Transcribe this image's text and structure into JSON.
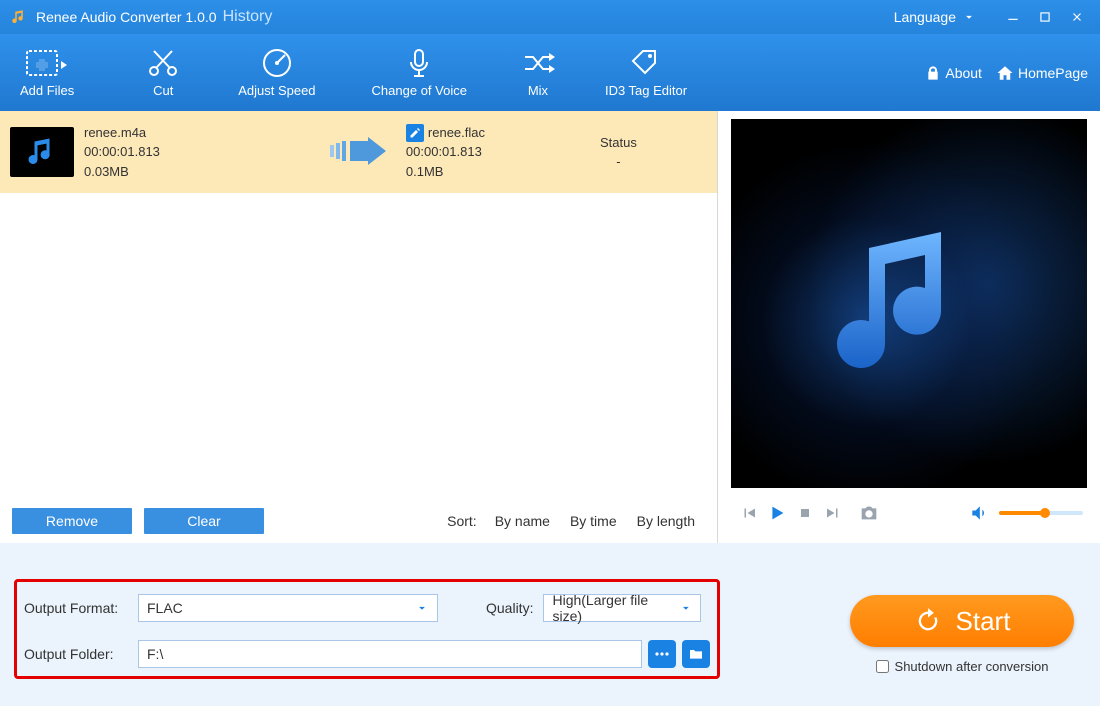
{
  "title": {
    "app": "Renee Audio Converter 1.0.0",
    "history": "History"
  },
  "window": {
    "language": "Language"
  },
  "toolbar": {
    "addfiles": "Add Files",
    "cut": "Cut",
    "adjust": "Adjust Speed",
    "voice": "Change of Voice",
    "mix": "Mix",
    "id3": "ID3 Tag Editor",
    "about": "About",
    "homepage": "HomePage"
  },
  "file": {
    "src": {
      "name": "renee.m4a",
      "duration": "00:00:01.813",
      "size": "0.03MB"
    },
    "dst": {
      "name": "renee.flac",
      "duration": "00:00:01.813",
      "size": "0.1MB"
    },
    "status_label": "Status",
    "status_value": "-"
  },
  "listfooter": {
    "remove": "Remove",
    "clear": "Clear",
    "sort_label": "Sort:",
    "by_name": "By name",
    "by_time": "By time",
    "by_length": "By length"
  },
  "output": {
    "format_label": "Output Format:",
    "format_value": "FLAC",
    "quality_label": "Quality:",
    "quality_value": "High(Larger file size)",
    "folder_label": "Output Folder:",
    "folder_value": "F:\\"
  },
  "start": {
    "label": "Start"
  },
  "shutdown": {
    "label": "Shutdown after conversion",
    "checked": false
  }
}
